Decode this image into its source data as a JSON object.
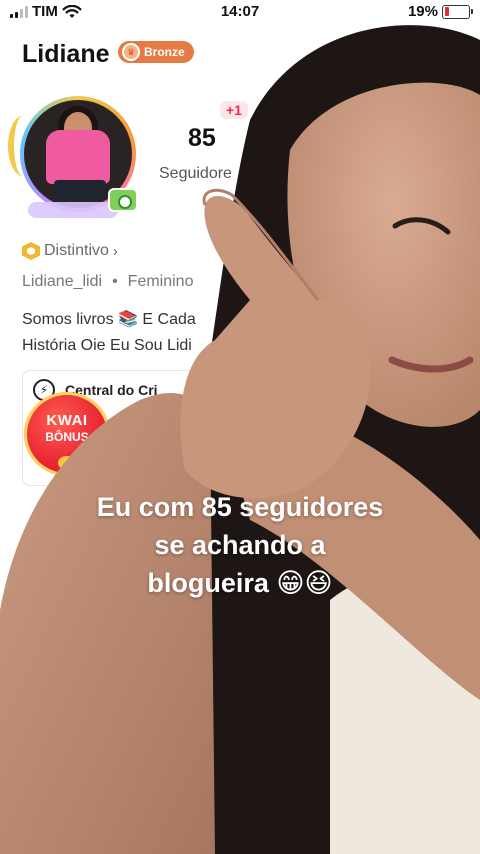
{
  "status_bar": {
    "carrier": "TIM",
    "time": "14:07",
    "battery_percent": "19%",
    "battery_level": 0.19
  },
  "profile": {
    "name": "Lidiane",
    "level_badge": "Bronze",
    "follow_delta": "+1",
    "followers_count": "85",
    "followers_label": "Seguidore",
    "badge_label": "Distintivo",
    "username": "Lidiane_lidi",
    "separator": "•",
    "gender": "Feminino",
    "bio_line1": "Somos livros 📚 E Cada",
    "bio_line2": "História Oie Eu Sou Lidi",
    "creator_center": "Central do Cri"
  },
  "kwai_bonus": {
    "line1": "KWAI",
    "line2": "BÔNUS"
  },
  "caption": {
    "line1": "Eu com 85 seguidores",
    "line2": "se achando a",
    "line3": "blogueira 😁😆"
  },
  "colors": {
    "level_badge": "#e67a45",
    "follow_delta": "#ef2f55",
    "battery_low": "#e52d2d"
  }
}
